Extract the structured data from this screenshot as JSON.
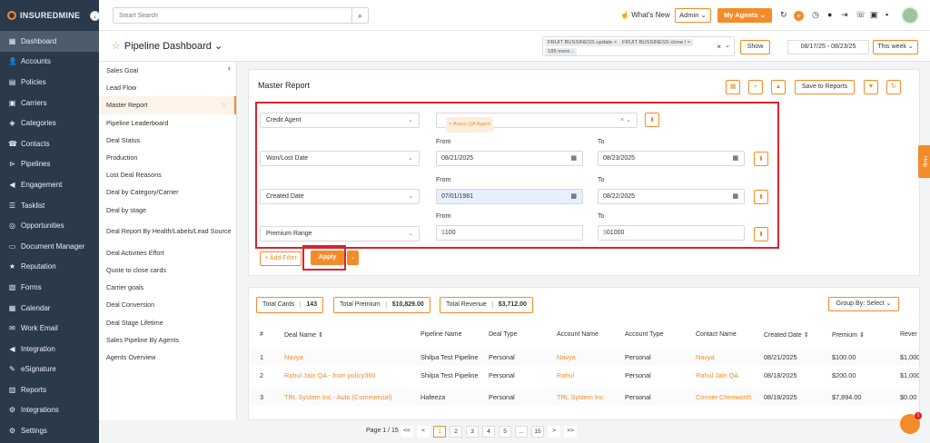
{
  "brand": {
    "name": "INSUREDMINE"
  },
  "sidebar": {
    "items": [
      {
        "label": "Dashboard",
        "icon": "dashboard-icon",
        "glyph": "▦"
      },
      {
        "label": "Accounts",
        "icon": "user-icon",
        "glyph": "👤"
      },
      {
        "label": "Policies",
        "icon": "policy-icon",
        "glyph": "▤"
      },
      {
        "label": "Carriers",
        "icon": "carrier-icon",
        "glyph": "▣"
      },
      {
        "label": "Categories",
        "icon": "categories-icon",
        "glyph": "◈"
      },
      {
        "label": "Contacts",
        "icon": "contacts-icon",
        "glyph": "☎"
      },
      {
        "label": "Pipelines",
        "icon": "pipeline-icon",
        "glyph": "⊳"
      },
      {
        "label": "Engagement",
        "icon": "megaphone-icon",
        "glyph": "◀"
      },
      {
        "label": "Tasklist",
        "icon": "tasklist-icon",
        "glyph": "☰"
      },
      {
        "label": "Opportunities",
        "icon": "opportunities-icon",
        "glyph": "◎"
      },
      {
        "label": "Document Manager",
        "icon": "folder-icon",
        "glyph": "▭"
      },
      {
        "label": "Reputation",
        "icon": "reputation-icon",
        "glyph": "★"
      },
      {
        "label": "Forms",
        "icon": "forms-icon",
        "glyph": "▧"
      },
      {
        "label": "Calendar",
        "icon": "calendar-icon",
        "glyph": "▦"
      },
      {
        "label": "Work Email",
        "icon": "email-icon",
        "glyph": "✉"
      },
      {
        "label": "Integration",
        "icon": "integration-icon",
        "glyph": "◀"
      },
      {
        "label": "eSignature",
        "icon": "signature-icon",
        "glyph": "✎"
      },
      {
        "label": "Reports",
        "icon": "reports-icon",
        "glyph": "▥"
      },
      {
        "label": "Integrations",
        "icon": "integrations-icon",
        "glyph": "⚙"
      },
      {
        "label": "Settings",
        "icon": "gear-icon",
        "glyph": "⚙"
      }
    ]
  },
  "topbar": {
    "search_placeholder": "Smart Search",
    "whats_new": "What's New",
    "admin": "Admin",
    "my_agents": "My Agents"
  },
  "subheader": {
    "title": "Pipeline Dashboard",
    "filter_chips": [
      "FRUIT BUSSINESS update",
      "FRUIT BUSSINESS clone l",
      "185 more..."
    ],
    "show": "Show",
    "date_range": "08/17/25 - 08/23/25",
    "period": "This week"
  },
  "report_list": {
    "items": [
      "Sales Goal",
      "Lead Flow",
      "Master Report",
      "Pipeline Leaderboard",
      "Deal Status",
      "Production",
      "Lost Deal Reasons",
      "Deal by Category/Carrier",
      "Deal by stage",
      "Deal Report By Health/Labels/Lead Source",
      "Deal Activities Effort",
      "Quote to close cards",
      "Carrier goals",
      "Deal Conversion",
      "Deal Stage Lifetime",
      "Sales Pipeline By Agents",
      "Agents Overview"
    ]
  },
  "master": {
    "title": "Master Report",
    "save_label": "Save to Reports",
    "filters": {
      "credit_agent": {
        "label": "Credit Agent",
        "value": "Arazo QA Agent"
      },
      "won_lost": {
        "label": "Won/Lost Date",
        "from_label": "From",
        "to_label": "To",
        "from": "08/21/2025",
        "to": "08/23/2025"
      },
      "created": {
        "label": "Created Date",
        "from_label": "From",
        "to_label": "To",
        "from": "07/01/1981",
        "to": "08/22/2025"
      },
      "premium": {
        "label": "Premium Range",
        "from_label": "From",
        "to_label": "To",
        "from": "100",
        "to": "01000",
        "prefix": "$"
      }
    },
    "add_filter": "+ Add Filter",
    "apply": "Apply"
  },
  "stats": [
    {
      "label": "Total Cards",
      "value": "143"
    },
    {
      "label": "Total Premium",
      "value": "$10,829.00"
    },
    {
      "label": "Total Revenue",
      "value": "$3,712.00"
    }
  ],
  "group_by": "Group By: Select",
  "table": {
    "headers": [
      "#",
      "Deal Name ⇕",
      "Pipeline Name",
      "Deal Type",
      "Account Name",
      "Account Type",
      "Contact Name",
      "Created Date ⇕",
      "Premium ⇕",
      "Rever"
    ],
    "rows": [
      [
        "1",
        "Navya",
        "Shilpa Test Pipeline",
        "Personal",
        "Navya",
        "Personal",
        "Navya",
        "08/21/2025",
        "$100.00",
        "$1,000"
      ],
      [
        "2",
        "Rahul Jain QA - from policy360",
        "Shilpa Test Pipeline",
        "Personal",
        "Rahul",
        "Personal",
        "Rahul Jain QA",
        "08/18/2025",
        "$200.00",
        "$1,000"
      ],
      [
        "3",
        "TRL System Inc - Auto (Commercial)",
        "Hafeeza",
        "Personal",
        "TRL System Inc",
        "Personal",
        "Conner Chenworth",
        "08/18/2025",
        "$7,894.00",
        "$0.00"
      ]
    ]
  },
  "pager": {
    "text": "Page 1 / 15",
    "pages": [
      "<<",
      "<",
      "1",
      "2",
      "3",
      "4",
      "5",
      "...",
      "15",
      ">",
      ">>"
    ]
  },
  "help_label": "Help",
  "chat_badge": "1"
}
